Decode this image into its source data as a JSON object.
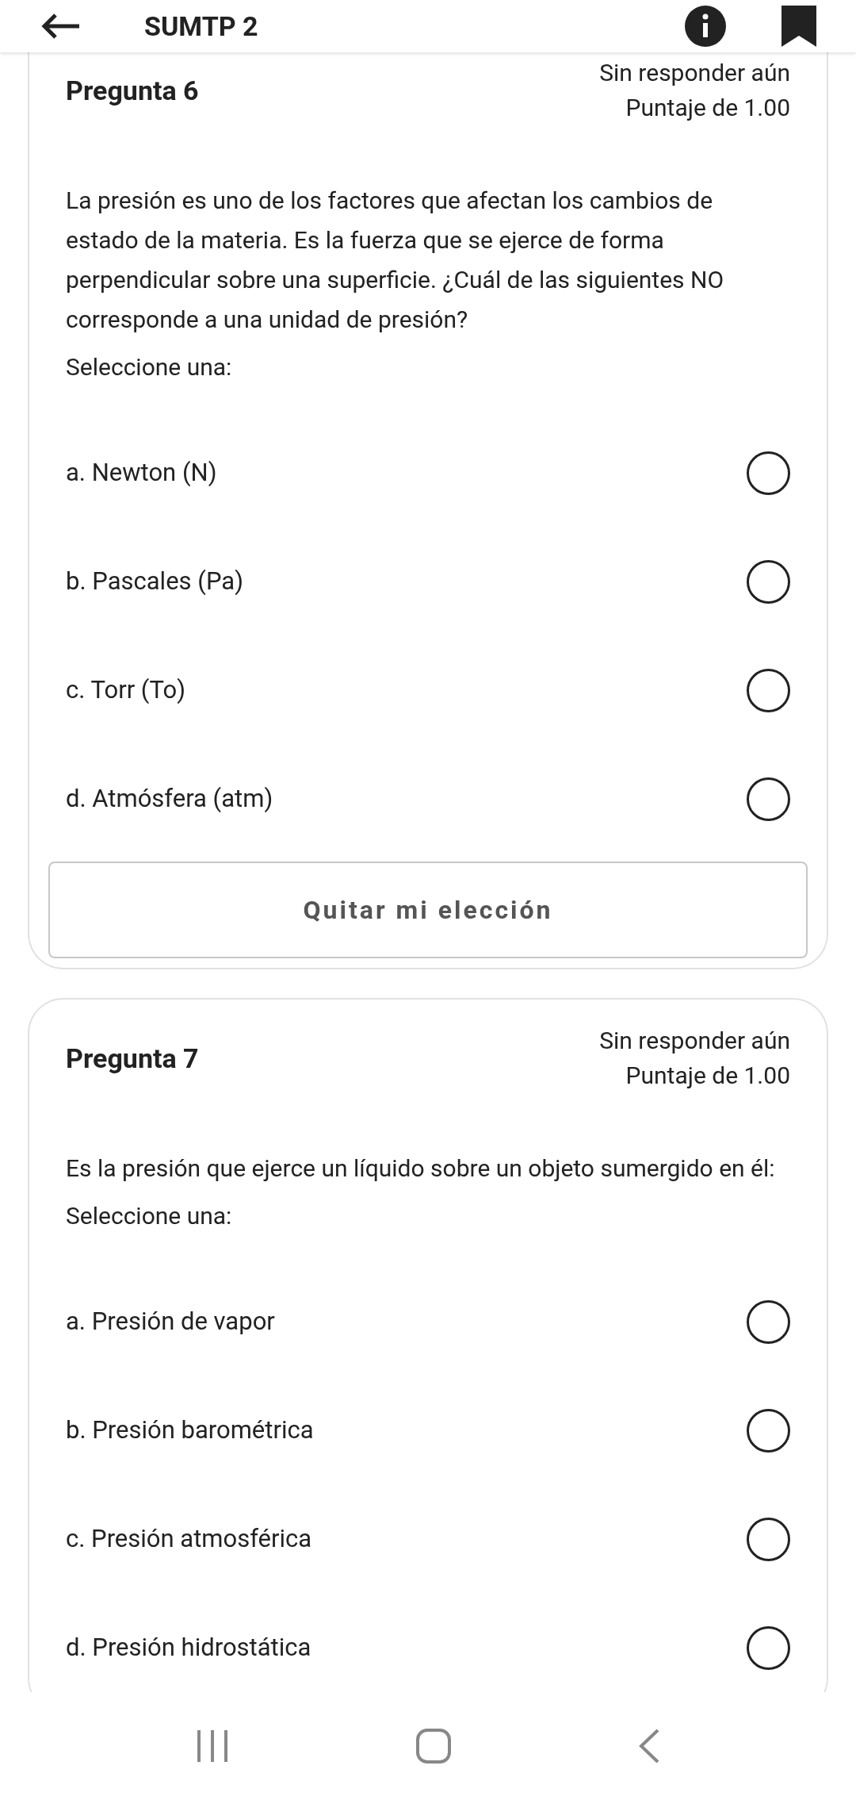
{
  "app_bar": {
    "title": "SUMTP 2"
  },
  "questions": [
    {
      "title": "Pregunta 6",
      "status": "Sin responder aún",
      "grade": "Puntaje de 1.00",
      "text": "La presión es uno de los factores que afectan los cambios de estado de la materia. Es la fuerza que se ejerce de forma perpendicular sobre una superficie. ¿Cuál de las siguientes NO corresponde a una unidad de presión?",
      "prompt": "Seleccione una:",
      "options": [
        {
          "label": "a. Newton (N)",
          "selected": false
        },
        {
          "label": "b. Pascales (Pa)",
          "selected": false
        },
        {
          "label": "c. Torr (To)",
          "selected": false
        },
        {
          "label": "d. Atmósfera (atm)",
          "selected": false
        }
      ],
      "clear_button": "Quitar mi elección"
    },
    {
      "title": "Pregunta 7",
      "status": "Sin responder aún",
      "grade": "Puntaje de 1.00",
      "text": "Es la presión que ejerce un líquido sobre un objeto sumergido en él:",
      "prompt": "Seleccione una:",
      "options": [
        {
          "label": "a. Presión de vapor",
          "selected": false
        },
        {
          "label": "b. Presión barométrica",
          "selected": false
        },
        {
          "label": "c. Presión atmosférica",
          "selected": false
        },
        {
          "label": "d. Presión hidrostática",
          "selected": false
        }
      ]
    }
  ]
}
